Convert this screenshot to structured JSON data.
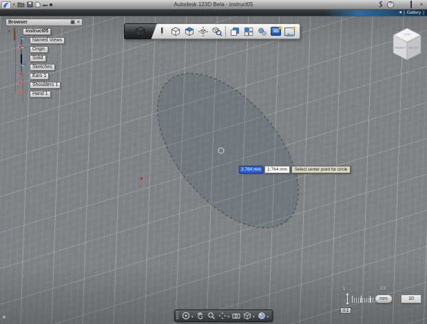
{
  "window": {
    "title": "Autodesk 123D Beta - instruct05"
  },
  "icons": {
    "dropdown_caret": "▾",
    "back_arrow": "◀",
    "separator": "|",
    "close": "×",
    "help": "?",
    "star": "★",
    "expander": "▪"
  },
  "gallery": {
    "label": "Gallery"
  },
  "browser": {
    "title": "Browser",
    "root_label": "instruct05",
    "items": [
      {
        "label": "Named Views",
        "visible": true,
        "icon": "folder"
      },
      {
        "label": "Origin",
        "visible": false,
        "icon": "folder"
      },
      {
        "label": "Solid",
        "visible": true,
        "icon": "solid"
      },
      {
        "label": "Sketches",
        "visible": true,
        "icon": "folder"
      },
      {
        "label": "Ears 1",
        "visible": false,
        "icon": "sketch"
      },
      {
        "label": "Shoulders 1",
        "visible": false,
        "icon": "sketch"
      },
      {
        "label": "Hand 1",
        "visible": false,
        "icon": "sketch"
      }
    ]
  },
  "toolbar": {
    "badge_3d": "3D"
  },
  "sketch": {
    "active_dimension": "2.764 mm",
    "secondary_dimension": "2.764 mm",
    "prompt": "Select center point for circle"
  },
  "scalebar": {
    "start": "1",
    "end": "2.5",
    "ratio": "0:1",
    "units": "mm",
    "grid_size": "10"
  },
  "viewcube": {
    "top": "TOP",
    "front": "FRONT",
    "right": "RIGHT"
  },
  "colors": {
    "accent_blue": "#2e63d4",
    "canvas_gray": "#7e8185",
    "hidden_red": "#d11c10",
    "sketch_green": "#3f5c42",
    "tooltip_beige": "#d9d6c3"
  }
}
